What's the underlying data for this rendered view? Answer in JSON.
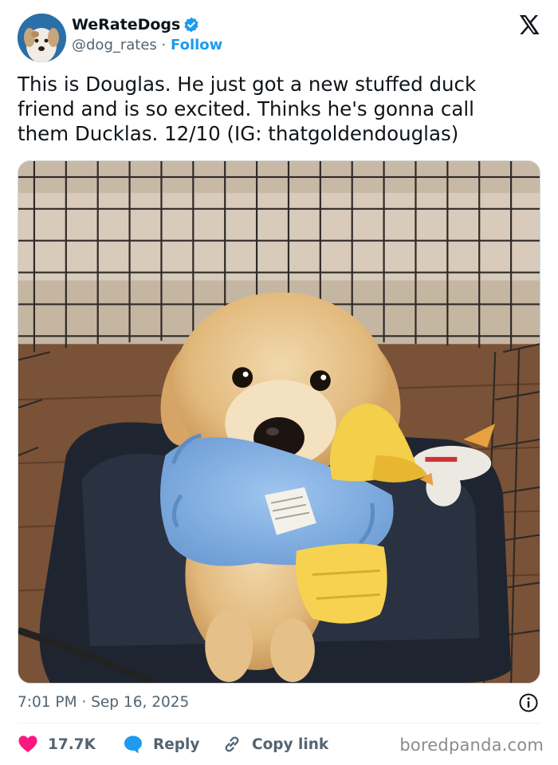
{
  "account": {
    "display_name": "WeRateDogs",
    "handle": "@dog_rates",
    "separator": "·",
    "follow_label": "Follow",
    "verified": true
  },
  "tweet": {
    "text": "This is Douglas. He just got a new stuffed duck\nfriend and is so excited. Thinks he's gonna call\nthem Ducklas. 12/10 (IG: thatgoldendouglas)",
    "timestamp": "7:01 PM · Sep 16, 2025"
  },
  "actions": {
    "like_count": "17.7K",
    "reply_label": "Reply",
    "copy_label": "Copy link"
  },
  "watermark": "boredpanda.com",
  "icons": {
    "logo": "x-logo-icon",
    "verified": "verified-badge-icon",
    "info": "info-icon",
    "like": "heart-icon",
    "reply": "reply-bubble-icon",
    "copy": "link-icon"
  },
  "colors": {
    "accent": "#1d9bf0",
    "like": "#f91880",
    "muted_text": "#536471",
    "text": "#0f1419",
    "watermark": "#8b8b8b"
  }
}
